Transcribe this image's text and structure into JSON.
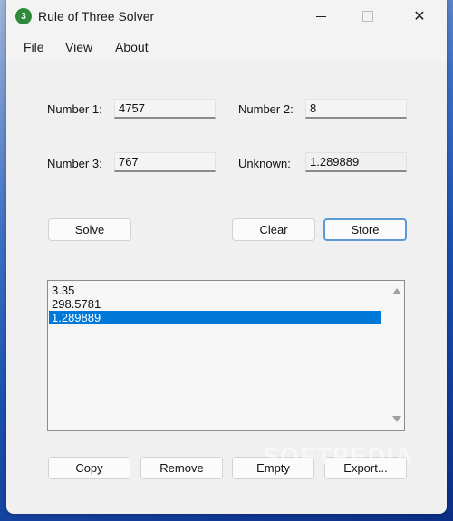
{
  "window": {
    "title": "Rule of Three Solver",
    "icon_glyph": "3",
    "controls": {
      "minimize": "minimize-icon",
      "maximize": "maximize-icon",
      "close": "close-icon",
      "close_glyph": "✕"
    }
  },
  "menu": [
    "File",
    "View",
    "About"
  ],
  "form": {
    "number1": {
      "label": "Number 1:",
      "value": "4757"
    },
    "number2": {
      "label": "Number 2:",
      "value": "8"
    },
    "number3": {
      "label": "Number 3:",
      "value": "767"
    },
    "unknown": {
      "label": "Unknown:",
      "value": "1.289889"
    }
  },
  "buttons": {
    "solve": "Solve",
    "clear": "Clear",
    "store": "Store"
  },
  "results": {
    "items": [
      "3.35",
      "298.5781",
      "1.289889"
    ],
    "selected_index": 2
  },
  "bottom_buttons": {
    "copy": "Copy",
    "remove": "Remove",
    "empty": "Empty",
    "export": "Export..."
  },
  "watermark": "SOFTPEDIA"
}
